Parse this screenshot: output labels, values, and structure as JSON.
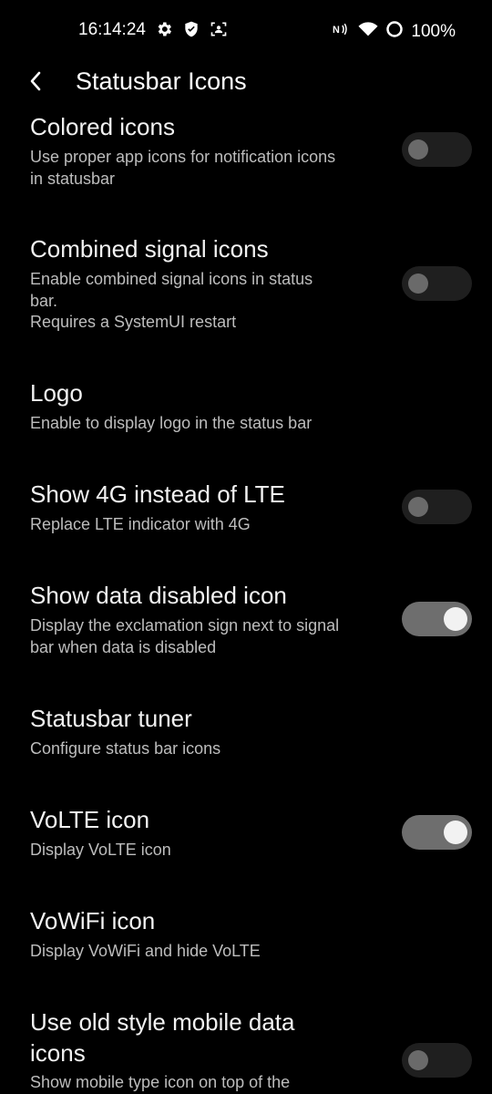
{
  "status_bar": {
    "time": "16:14:24",
    "battery": "100%",
    "icons_left": [
      "gear-icon",
      "shield-icon",
      "screenshot-icon"
    ],
    "icons_right": [
      "nfc-icon",
      "wifi-icon",
      "battery-ring-icon"
    ]
  },
  "header": {
    "title": "Statusbar Icons",
    "back_icon": "chevron-left-icon"
  },
  "settings": [
    {
      "title": "Colored icons",
      "summary": [
        "Use proper app icons for notification icons",
        "in statusbar"
      ],
      "toggle": "off"
    },
    {
      "title": "Combined signal icons",
      "summary": [
        "Enable combined signal icons in status",
        "bar.",
        "Requires a SystemUI restart"
      ],
      "toggle": "off"
    },
    {
      "title": "Logo",
      "summary": [
        "Enable to display logo in the status bar"
      ],
      "toggle": null
    },
    {
      "title": "Show 4G instead of LTE",
      "summary": [
        "Replace LTE indicator with 4G"
      ],
      "toggle": "off"
    },
    {
      "title": "Show data disabled icon",
      "summary": [
        "Display the exclamation sign next to signal",
        "bar when data is disabled"
      ],
      "toggle": "on"
    },
    {
      "title": "Statusbar tuner",
      "summary": [
        "Configure status bar icons"
      ],
      "toggle": null
    },
    {
      "title": "VoLTE icon",
      "summary": [
        "Display VoLTE icon"
      ],
      "toggle": "on"
    },
    {
      "title": "VoWiFi icon",
      "summary": [
        "Display VoWiFi and hide VoLTE"
      ],
      "toggle": null
    },
    {
      "title": "Use old style mobile data\nicons",
      "summary": [
        "Show mobile type icon on top of the"
      ],
      "toggle": "off"
    }
  ],
  "colors": {
    "background": "#000000",
    "title_text": "#f2f2f2",
    "summary_text": "#bdbdbd",
    "toggle_off_track": "#1f1f1f",
    "toggle_on_track": "#6e6e6e"
  }
}
